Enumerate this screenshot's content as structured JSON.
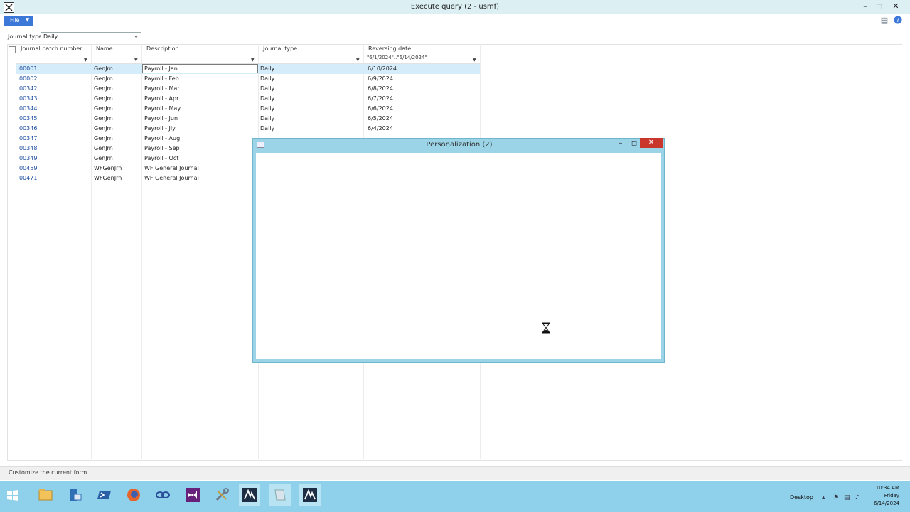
{
  "window": {
    "title": "Execute query (2 - usmf)"
  },
  "menu": {
    "file_label": "File"
  },
  "filter": {
    "label": "Journal type:",
    "value": "Daily"
  },
  "columns": {
    "batch": "Journal batch number",
    "name": "Name",
    "description": "Description",
    "journal_type": "Journal type",
    "reversing_date": "Reversing date",
    "reversing_filter": "\"6/1/2024\"..\"6/14/2024\""
  },
  "rows": [
    {
      "id": "00001",
      "name": "GenJrn",
      "desc": "Payroll - Jan",
      "type": "Daily",
      "date": "6/10/2024"
    },
    {
      "id": "00002",
      "name": "GenJrn",
      "desc": "Payroll - Feb",
      "type": "Daily",
      "date": "6/9/2024"
    },
    {
      "id": "00342",
      "name": "GenJrn",
      "desc": "Payroll - Mar",
      "type": "Daily",
      "date": "6/8/2024"
    },
    {
      "id": "00343",
      "name": "GenJrn",
      "desc": "Payroll - Apr",
      "type": "Daily",
      "date": "6/7/2024"
    },
    {
      "id": "00344",
      "name": "GenJrn",
      "desc": "Payroll - May",
      "type": "Daily",
      "date": "6/6/2024"
    },
    {
      "id": "00345",
      "name": "GenJrn",
      "desc": "Payroll - Jun",
      "type": "Daily",
      "date": "6/5/2024"
    },
    {
      "id": "00346",
      "name": "GenJrn",
      "desc": "Payroll - Jly",
      "type": "Daily",
      "date": "6/4/2024"
    },
    {
      "id": "00347",
      "name": "GenJrn",
      "desc": "Payroll - Aug",
      "type": "",
      "date": ""
    },
    {
      "id": "00348",
      "name": "GenJrn",
      "desc": "Payroll - Sep",
      "type": "",
      "date": ""
    },
    {
      "id": "00349",
      "name": "GenJrn",
      "desc": "Payroll - Oct",
      "type": "",
      "date": ""
    },
    {
      "id": "00459",
      "name": "WFGenJrn",
      "desc": "WF General Journal",
      "type": "",
      "date": ""
    },
    {
      "id": "00471",
      "name": "WFGenJrn",
      "desc": "WF General Journal",
      "type": "",
      "date": ""
    }
  ],
  "popup": {
    "title": "Personalization (2)"
  },
  "status": {
    "text": "Customize the current form"
  },
  "taskbar": {
    "desktop_label": "Desktop",
    "time": "10:34 AM",
    "day": "Friday",
    "date": "6/14/2024"
  },
  "colors": {
    "accent": "#3c78d8",
    "popup_frame": "#9ad4e6",
    "taskbar": "#8fd0ea",
    "close": "#c9362b"
  }
}
